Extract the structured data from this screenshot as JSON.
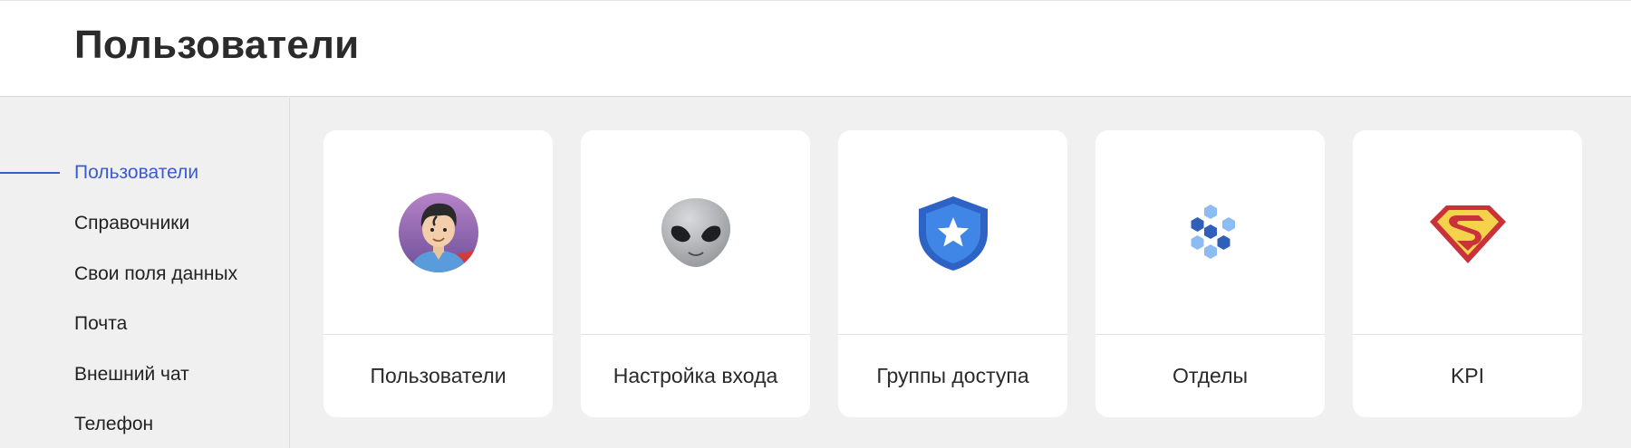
{
  "header": {
    "title": "Пользователи"
  },
  "sidebar": {
    "items": [
      {
        "label": "Пользователи",
        "active": true
      },
      {
        "label": "Справочники"
      },
      {
        "label": "Свои поля данных"
      },
      {
        "label": "Почта"
      },
      {
        "label": "Внешний чат"
      },
      {
        "label": "Телефон"
      }
    ],
    "accent_color": "#3a5bd0"
  },
  "cards": [
    {
      "label": "Пользователи",
      "icon": "superman-avatar-icon"
    },
    {
      "label": "Настройка входа",
      "icon": "alien-icon"
    },
    {
      "label": "Группы доступа",
      "icon": "shield-star-icon"
    },
    {
      "label": "Отделы",
      "icon": "hexagon-cluster-icon"
    },
    {
      "label": "KPI",
      "icon": "superman-logo-icon"
    }
  ]
}
